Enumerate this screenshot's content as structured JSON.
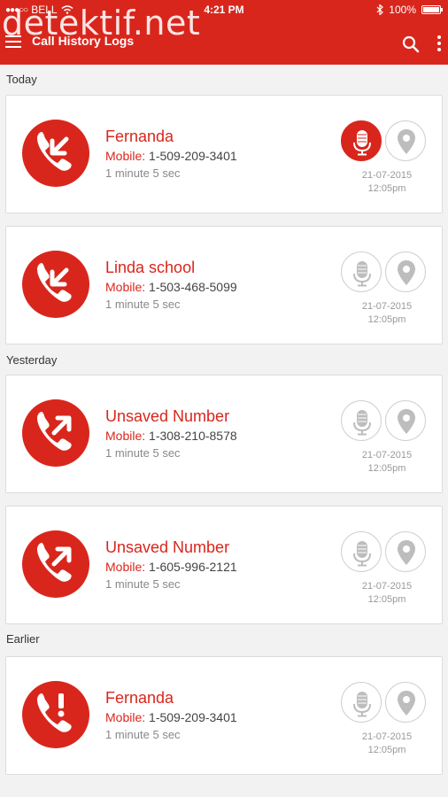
{
  "status_bar": {
    "carrier": "BELL",
    "time": "4:21 PM",
    "battery": "100%"
  },
  "watermark": "detektif.net",
  "app_bar": {
    "title": "Call History Logs",
    "menu_icon": "hamburger-menu-icon",
    "search_icon": "search-icon",
    "more_icon": "more-vert-icon"
  },
  "colors": {
    "accent": "#d9261c",
    "muted": "#999999",
    "background": "#f2f2f2"
  },
  "sections": [
    {
      "label": "Today",
      "calls": [
        {
          "name": "Fernanda",
          "type_label": "Mobile:",
          "number": "1-509-209-3401",
          "duration": "1 minute 5 sec",
          "date": "21-07-2015",
          "time": "12:05pm",
          "direction": "incoming",
          "recording_active": true
        },
        {
          "name": "Linda school",
          "type_label": "Mobile:",
          "number": "1-503-468-5099",
          "duration": "1 minute 5 sec",
          "date": "21-07-2015",
          "time": "12:05pm",
          "direction": "incoming",
          "recording_active": false
        }
      ]
    },
    {
      "label": "Yesterday",
      "calls": [
        {
          "name": "Unsaved Number",
          "type_label": "Mobile:",
          "number": "1-308-210-8578",
          "duration": "1 minute 5 sec",
          "date": "21-07-2015",
          "time": "12:05pm",
          "direction": "outgoing",
          "recording_active": false
        },
        {
          "name": "Unsaved Number",
          "type_label": "Mobile:",
          "number": "1-605-996-2121",
          "duration": "1 minute 5 sec",
          "date": "21-07-2015",
          "time": "12:05pm",
          "direction": "outgoing",
          "recording_active": false
        }
      ]
    },
    {
      "label": "Earlier",
      "calls": [
        {
          "name": "Fernanda",
          "type_label": "Mobile:",
          "number": "1-509-209-3401",
          "duration": "1 minute 5 sec",
          "date": "21-07-2015",
          "time": "12:05pm",
          "direction": "missed",
          "recording_active": false
        }
      ]
    }
  ]
}
